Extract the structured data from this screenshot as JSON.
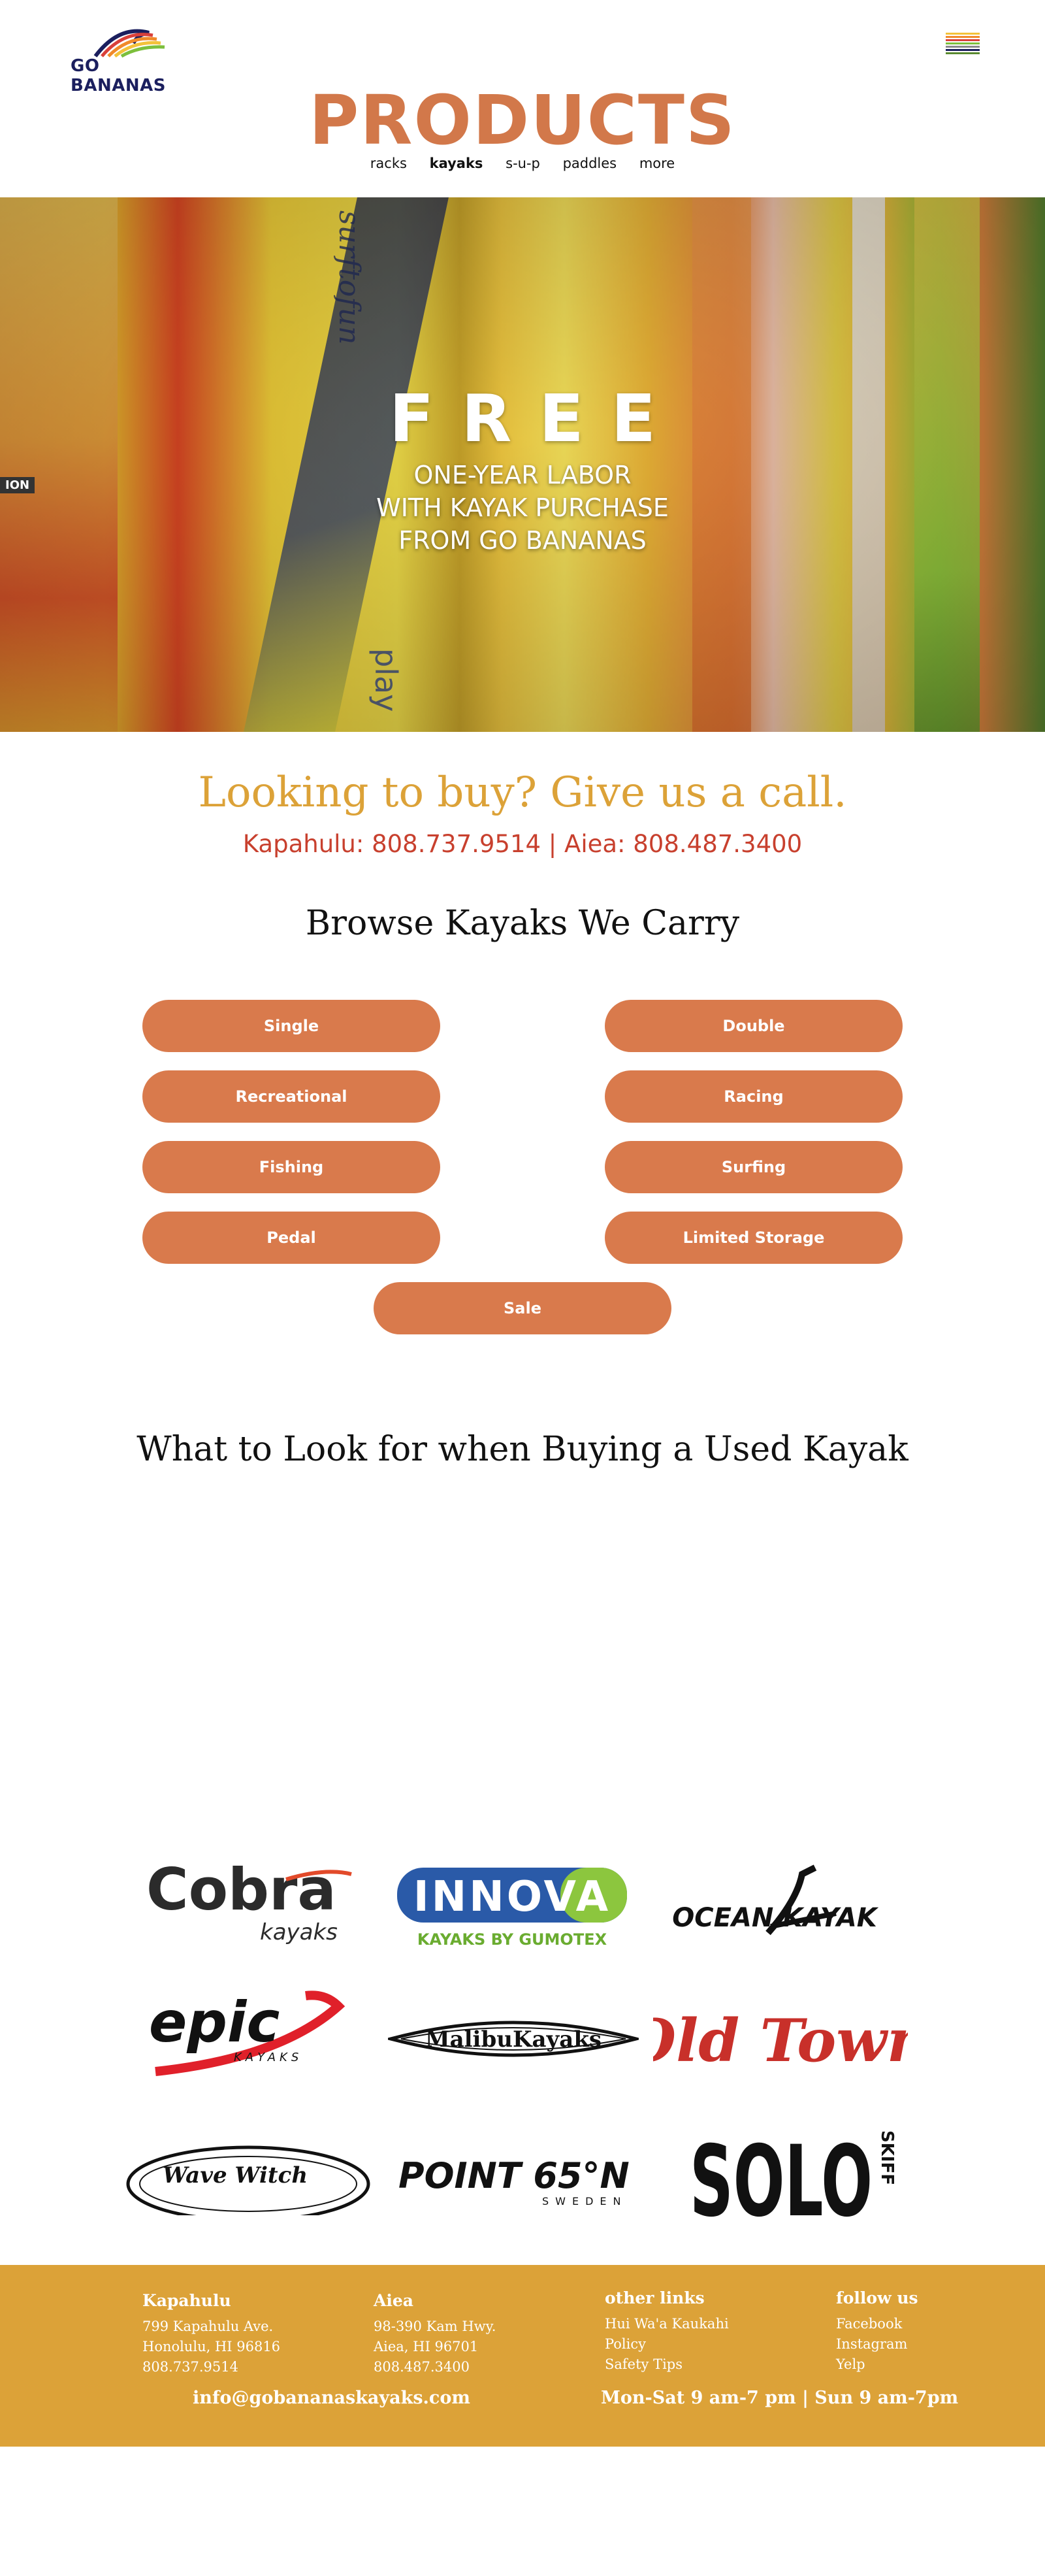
{
  "header": {
    "logo_text": "GO BANANAS",
    "title": "PRODUCTS",
    "nav": [
      {
        "label": "racks"
      },
      {
        "label": "kayaks",
        "active": true
      },
      {
        "label": "s-u-p"
      },
      {
        "label": "paddles"
      },
      {
        "label": "more"
      }
    ],
    "menu_icon": "hamburger-icon"
  },
  "hero": {
    "headline": "FREE",
    "lines": [
      "ONE-YEAR LABOR",
      "WITH KAYAK PURCHASE",
      "FROM GO BANANAS"
    ],
    "image_text": [
      "surftofun",
      "play",
      "ION"
    ]
  },
  "call": {
    "title": "Looking to buy? Give us a call.",
    "phones": "Kapahulu: 808.737.9514 | Aiea: 808.487.3400"
  },
  "browse": {
    "title": "Browse Kayaks We Carry",
    "categories": [
      "Single",
      "Double",
      "Recreational",
      "Racing",
      "Fishing",
      "Surfing",
      "Pedal",
      "Limited Storage",
      "Sale"
    ]
  },
  "guide": {
    "title": "What to Look for when Buying a Used Kayak"
  },
  "brands": [
    {
      "name": "Cobra",
      "sub": "kayaks"
    },
    {
      "name": "INNOVA",
      "sub": "KAYAKS BY GUMOTEX"
    },
    {
      "name": "OCEAN KAYAK"
    },
    {
      "name": "epic",
      "sub": "KAYAKS"
    },
    {
      "name": "MalibuKayaks"
    },
    {
      "name": "Old Town"
    },
    {
      "name": "Wave Witch"
    },
    {
      "name": "POINT 65°N",
      "sub": "SWEDEN"
    },
    {
      "name": "SOLO",
      "sub": "SKIFF"
    }
  ],
  "footer": {
    "kapahulu": {
      "title": "Kapahulu",
      "lines": [
        "799 Kapahulu Ave.",
        "Honolulu, HI 96816",
        "808.737.9514"
      ]
    },
    "aiea": {
      "title": "Aiea",
      "lines": [
        "98-390 Kam Hwy.",
        "Aiea, HI 96701",
        "808.487.3400"
      ]
    },
    "other_links": {
      "title": "other links",
      "lines": [
        "Hui Wa'a Kaukahi",
        "Policy",
        "Safety Tips"
      ]
    },
    "follow_us": {
      "title": "follow us",
      "lines": [
        "Facebook",
        "Instagram",
        "Yelp"
      ]
    },
    "email": "info@gobananaskayaks.com",
    "hours": "Mon-Sat 9 am-7 pm | Sun 9 am-7pm"
  },
  "colors": {
    "accent": "#d97a4c",
    "gold": "#dca238",
    "phone_red": "#c8402e",
    "logo_navy": "#1b1f5e"
  }
}
